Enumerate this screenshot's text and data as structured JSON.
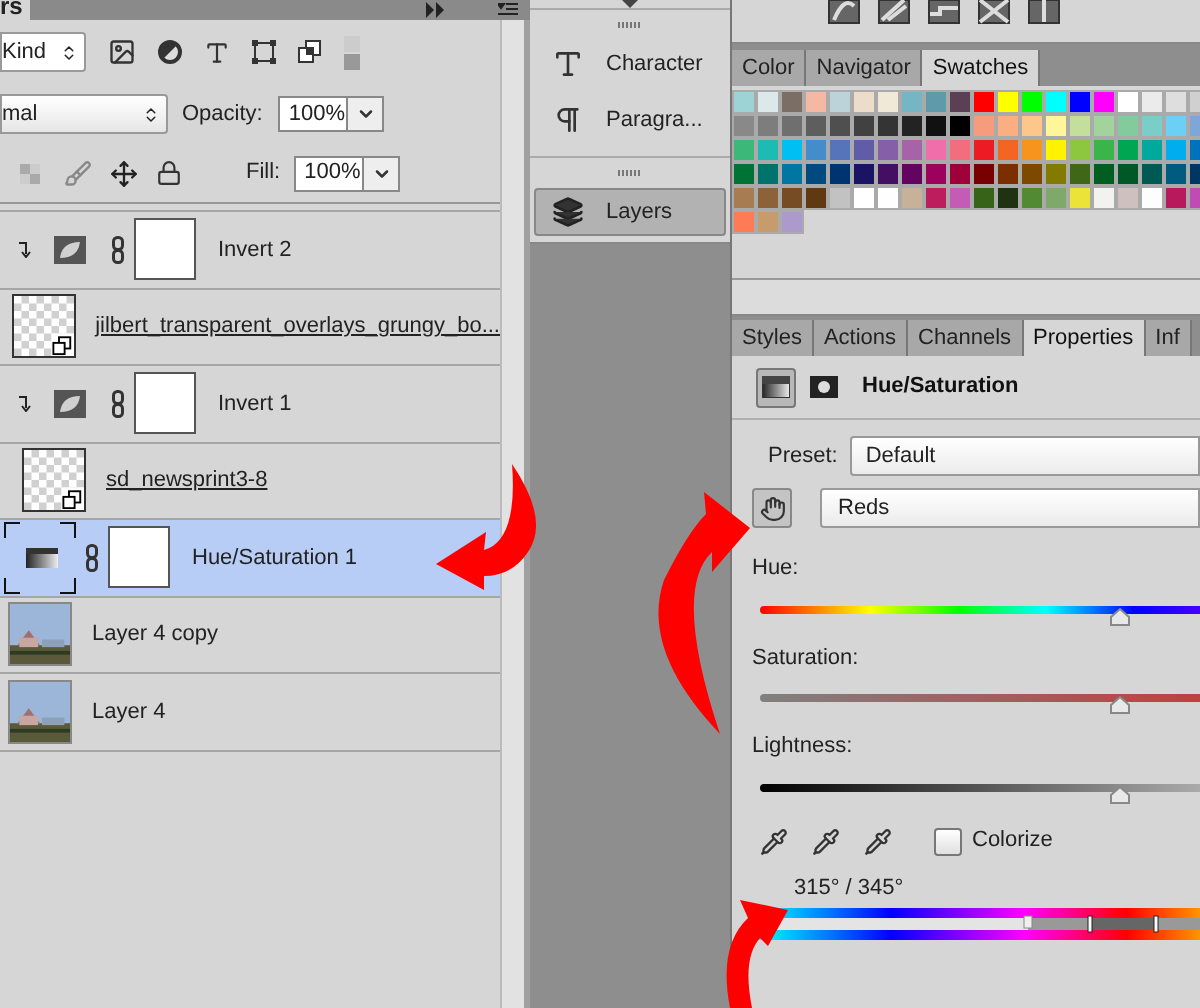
{
  "layers_panel": {
    "tab_label": "rs",
    "filter": {
      "value": "Kind"
    },
    "blend_mode": {
      "value": "mal"
    },
    "opacity": {
      "label": "Opacity:",
      "value": "100%"
    },
    "fill": {
      "label": "Fill:",
      "value": "100%"
    },
    "layers": [
      {
        "name": "Invert 2",
        "kind": "invert",
        "clipped": true,
        "selected": false
      },
      {
        "name": "jilbert_transparent_overlays_grungy_bo...",
        "kind": "smart_object",
        "clipped": false,
        "selected": false
      },
      {
        "name": "Invert 1",
        "kind": "invert",
        "clipped": true,
        "selected": false
      },
      {
        "name": "sd_newsprint3-8",
        "kind": "smart_object",
        "clipped": false,
        "selected": false
      },
      {
        "name": "Hue/Saturation 1",
        "kind": "hue_saturation",
        "clipped": false,
        "selected": true
      },
      {
        "name": "Layer 4 copy",
        "kind": "pixel",
        "clipped": false,
        "selected": false
      },
      {
        "name": "Layer 4",
        "kind": "pixel",
        "clipped": false,
        "selected": false
      }
    ]
  },
  "dock": {
    "items": [
      {
        "label": "Character",
        "kind": "character",
        "selected": false
      },
      {
        "label": "Paragra...",
        "kind": "paragraph",
        "selected": false
      },
      {
        "label": "Layers",
        "kind": "layers",
        "selected": true
      }
    ]
  },
  "swatches_panel": {
    "tabs": [
      {
        "label": "Color",
        "selected": false
      },
      {
        "label": "Navigator",
        "selected": false
      },
      {
        "label": "Swatches",
        "selected": true
      }
    ],
    "swatch_rows": [
      [
        {
          "color": "#9ed3d6"
        },
        {
          "color": "#dce8ea"
        },
        {
          "color": "#7b6e64"
        },
        {
          "color": "#f4b8a5"
        },
        {
          "color": "#bcd4d9"
        },
        {
          "color": "#eedccb"
        },
        {
          "color": "#f1e9d8"
        },
        {
          "color": "#76b5c3"
        },
        {
          "color": "#5f9aa8"
        },
        {
          "color": "#5a3f55"
        },
        {
          "color": "#ff0000"
        },
        {
          "color": "#ffff00"
        },
        {
          "color": "#00ff00"
        },
        {
          "color": "#00ffff"
        },
        {
          "color": "#0000ff"
        },
        {
          "color": "#ff00ff"
        },
        {
          "color": "#ffffff"
        },
        {
          "color": "#ebebeb"
        },
        {
          "color": "#dedede"
        },
        {
          "color": "#d0d0d0"
        }
      ],
      [
        {
          "color": "#898989"
        },
        {
          "color": "#7d7d7d"
        },
        {
          "color": "#6f6f6f"
        },
        {
          "color": "#5e5e5e"
        },
        {
          "color": "#4f4f4f"
        },
        {
          "color": "#414141"
        },
        {
          "color": "#343434"
        },
        {
          "color": "#232323"
        },
        {
          "color": "#111111"
        },
        {
          "color": "#000000"
        },
        {
          "color": "#f79b7d"
        },
        {
          "color": "#fbae82"
        },
        {
          "color": "#fdc68b"
        },
        {
          "color": "#fff69a"
        },
        {
          "color": "#c4df9b"
        },
        {
          "color": "#a2d39c"
        },
        {
          "color": "#83ca9d"
        },
        {
          "color": "#7bcdc8"
        },
        {
          "color": "#6ccff6"
        },
        {
          "color": "#7ea7d8"
        }
      ],
      [
        {
          "color": "#3cb878"
        },
        {
          "color": "#1cbbb4"
        },
        {
          "color": "#00bff3"
        },
        {
          "color": "#448ccb"
        },
        {
          "color": "#5574b9"
        },
        {
          "color": "#605ca8"
        },
        {
          "color": "#8560a8"
        },
        {
          "color": "#a763a8"
        },
        {
          "color": "#f06eaa"
        },
        {
          "color": "#f26d7d"
        },
        {
          "color": "#ed1c24"
        },
        {
          "color": "#f26522"
        },
        {
          "color": "#f7941d"
        },
        {
          "color": "#fff200"
        },
        {
          "color": "#8dc63f"
        },
        {
          "color": "#39b54a"
        },
        {
          "color": "#00a651"
        },
        {
          "color": "#00a99d"
        },
        {
          "color": "#00aeef"
        },
        {
          "color": "#0072bc"
        }
      ],
      [
        {
          "color": "#007236"
        },
        {
          "color": "#00746b"
        },
        {
          "color": "#0076a3"
        },
        {
          "color": "#004a80"
        },
        {
          "color": "#003471"
        },
        {
          "color": "#1b1464"
        },
        {
          "color": "#440e62"
        },
        {
          "color": "#630460"
        },
        {
          "color": "#9e005d"
        },
        {
          "color": "#9e0039"
        },
        {
          "color": "#790000"
        },
        {
          "color": "#7b2e00"
        },
        {
          "color": "#7d4900"
        },
        {
          "color": "#827b00"
        },
        {
          "color": "#406618"
        },
        {
          "color": "#005e20"
        },
        {
          "color": "#005826"
        },
        {
          "color": "#005952"
        },
        {
          "color": "#005b7f"
        },
        {
          "color": "#003663"
        }
      ],
      [
        {
          "color": "#a67c52"
        },
        {
          "color": "#8c6239"
        },
        {
          "color": "#754c24"
        },
        {
          "color": "#603913"
        },
        {
          "color": "#c2c2c2"
        },
        {
          "color": "#ffffff"
        },
        {
          "color": "#fefefe"
        },
        {
          "color": "#c7b299"
        },
        {
          "color": "#bd1d5c"
        },
        {
          "color": "#c45cb5"
        },
        {
          "color": "#376319"
        },
        {
          "color": "#1f3312"
        },
        {
          "color": "#518a32"
        },
        {
          "color": "#80a86b"
        },
        {
          "color": "#ebe338"
        },
        {
          "color": "#f2f2ee"
        },
        {
          "color": "#cfc0c0"
        },
        {
          "color": "#fdfdfd"
        },
        {
          "color": "#b8195d"
        },
        {
          "color": "#c14bb5"
        }
      ],
      [
        {
          "color": "#ff7b55"
        },
        {
          "color": "#c69c6d"
        },
        {
          "color": "#ad9acd"
        }
      ]
    ]
  },
  "properties_panel": {
    "tabs": [
      {
        "label": "Styles",
        "selected": false
      },
      {
        "label": "Actions",
        "selected": false
      },
      {
        "label": "Channels",
        "selected": false
      },
      {
        "label": "Properties",
        "selected": true
      },
      {
        "label": "Inf",
        "selected": false
      }
    ],
    "title": "Hue/Saturation",
    "preset": {
      "label": "Preset:",
      "value": "Default"
    },
    "channel": {
      "value": "Reds"
    },
    "sliders": [
      {
        "label": "Hue:",
        "kind": "hue",
        "level": 0.82
      },
      {
        "label": "Saturation:",
        "kind": "saturation",
        "level": 0.82
      },
      {
        "label": "Lightness:",
        "kind": "lightness",
        "level": 0.82
      }
    ],
    "colorize": {
      "label": "Colorize",
      "checked": false
    },
    "range_reading": "315° / 345°"
  }
}
